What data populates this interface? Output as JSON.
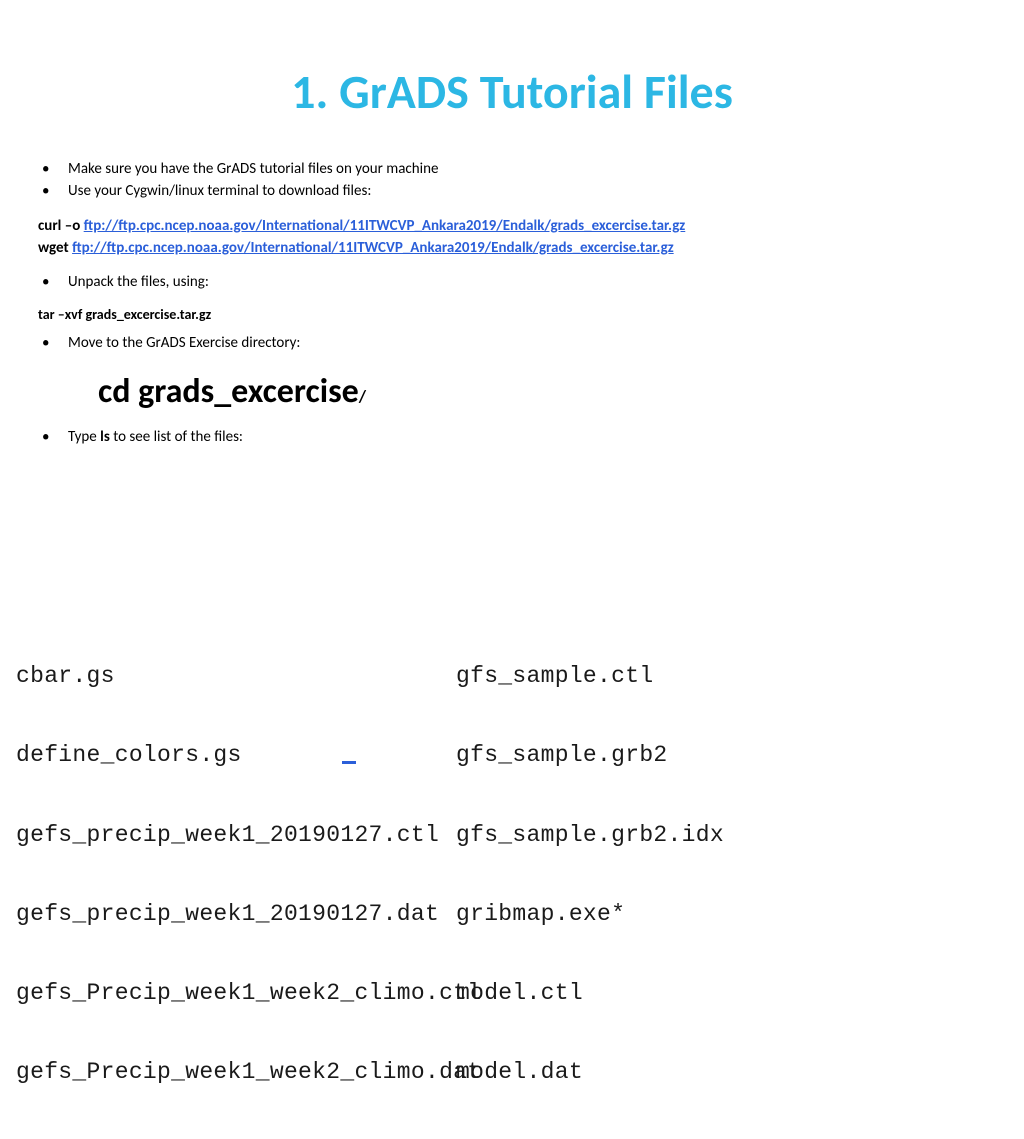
{
  "title": "1. GrADS Tutorial Files",
  "bullets1": [
    "Make sure you have the GrADS tutorial files on your machine",
    "Use your Cygwin/linux terminal to download files:"
  ],
  "curl_prefix": "curl –o ",
  "curl_link": "ftp://ftp.cpc.ncep.noaa.gov/International/11ITWCVP_Ankara2019/Endalk/grads_excercise.tar.gz",
  "wget_prefix": "wget ",
  "wget_link": "ftp://ftp.cpc.ncep.noaa.gov/International/11ITWCVP_Ankara2019/Endalk/grads_excercise.tar.gz",
  "bullets2": [
    "Unpack the files, using:"
  ],
  "tar_cmd": "tar –xvf ",
  "tar_file": "grads_excercise.tar.gz",
  "bullets3": [
    "Move to the GrADS Exercise directory:"
  ],
  "cd_cmd": "cd  grads_excercise",
  "cd_slash": "/",
  "bullets4_pre": "Type ",
  "bullets4_ls": "ls",
  "bullets4_post": " to see list of the files:",
  "files": {
    "col1": [
      "cbar.gs",
      "define_colors.gs",
      "gefs_precip_week1_20190127.ctl",
      "gefs_precip_week1_20190127.dat",
      "gefs_Precip_week1_week2_climo.ctl",
      "gefs_Precip_week1_week2_climo.dat"
    ],
    "col2": [
      "gfs_sample.ctl",
      "gfs_sample.grb2",
      "gfs_sample.grb2.idx",
      "gribmap.exe*",
      "model.ctl",
      "model.dat"
    ]
  }
}
